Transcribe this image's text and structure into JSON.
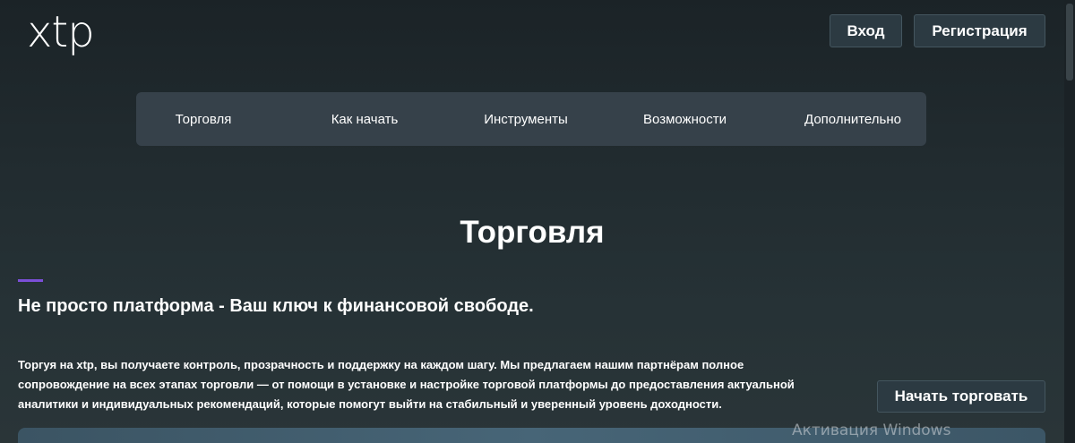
{
  "header": {
    "logo": "xtp",
    "login_label": "Вход",
    "register_label": "Регистрация"
  },
  "nav": {
    "items": [
      {
        "label": "Торговля"
      },
      {
        "label": "Как начать"
      },
      {
        "label": "Инструменты"
      },
      {
        "label": "Возможности"
      },
      {
        "label": "Дополнительно"
      }
    ]
  },
  "main": {
    "title": "Торговля",
    "subtitle": "Не просто платформа - Ваш ключ к финансовой свободе.",
    "description": "Торгуя на xtp, вы получаете контроль, прозрачность и поддержку на каждом шагу. Мы предлагаем нашим партнёрам полное сопровождение на всех этапах торговли — от помощи в установке и настройке торговой платформы до предоставления актуальной аналитики и индивидуальных рекомендаций, которые помогут выйти на стабильный и уверенный уровень доходности.",
    "start_button": "Начать торговать"
  },
  "overlay": {
    "watermark": "Активация Windows"
  },
  "colors": {
    "accent": "#7b4fd8",
    "nav_bg": "#36414a",
    "button_bg": "#2c3a42"
  }
}
